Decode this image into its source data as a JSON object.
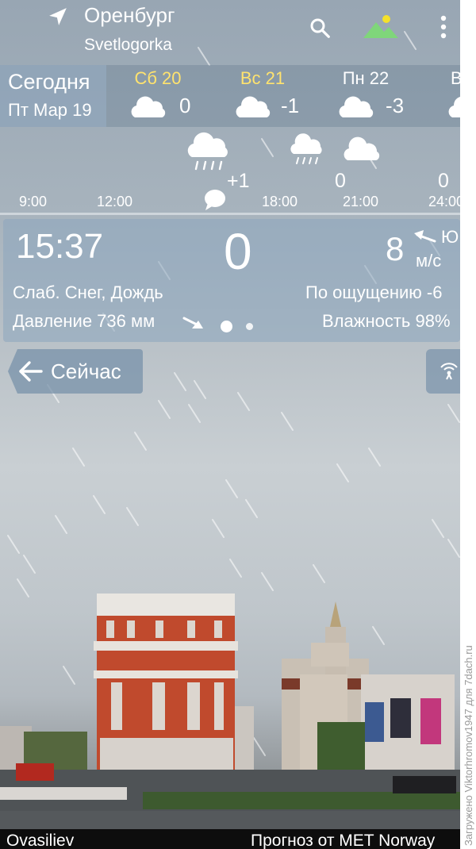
{
  "header": {
    "city": "Оренбург",
    "district": "Svetlogorka",
    "icons": [
      "location-arrow-icon",
      "search-icon",
      "landscape-icon",
      "more-vert-icon"
    ]
  },
  "days": {
    "today_title": "Сегодня",
    "today_date": "Пт Мар 19",
    "items": [
      {
        "name": "Сб 20",
        "temp": "0",
        "icon": "cloud-icon",
        "weekend": true
      },
      {
        "name": "Вс 21",
        "temp": "-1",
        "icon": "cloud-icon",
        "weekend": true
      },
      {
        "name": "Пн 22",
        "temp": "-3",
        "icon": "cloud-icon",
        "weekend": false
      },
      {
        "name": "В",
        "temp": "",
        "icon": "cloud-icon",
        "weekend": false
      }
    ]
  },
  "hourly": {
    "times": [
      "9:00",
      "12:00",
      "18:00",
      "21:00",
      "24:00"
    ],
    "temps": [
      "+1",
      "0",
      "0"
    ],
    "icons": [
      "rain-cloud-icon",
      "rain-cloud-icon",
      "cloud-icon",
      "speech-bubble-icon"
    ]
  },
  "now": {
    "time": "15:37",
    "temp": "0",
    "wind_speed": "8",
    "wind_dir": "Ю",
    "wind_unit": "м/с",
    "condition": "Слаб. Снег, Дождь",
    "feels_like": "По ощущению -6",
    "pressure": "Давление 736 мм",
    "humidity": "Влажность 98%",
    "page_dots": 2,
    "active_page": 1
  },
  "buttons": {
    "now_label": "Сейчас"
  },
  "footer": {
    "photo_credit": "Ovasiliev",
    "forecast_credit": "Прогноз от MET Norway"
  },
  "watermark": "Загружено Viktorhromov1947 для 7dach.ru",
  "colors": {
    "weekend": "#ffe36e",
    "landscape_sun": "#f5e12a",
    "landscape_hill": "#7fd67a",
    "panel": "#8ca5be"
  }
}
